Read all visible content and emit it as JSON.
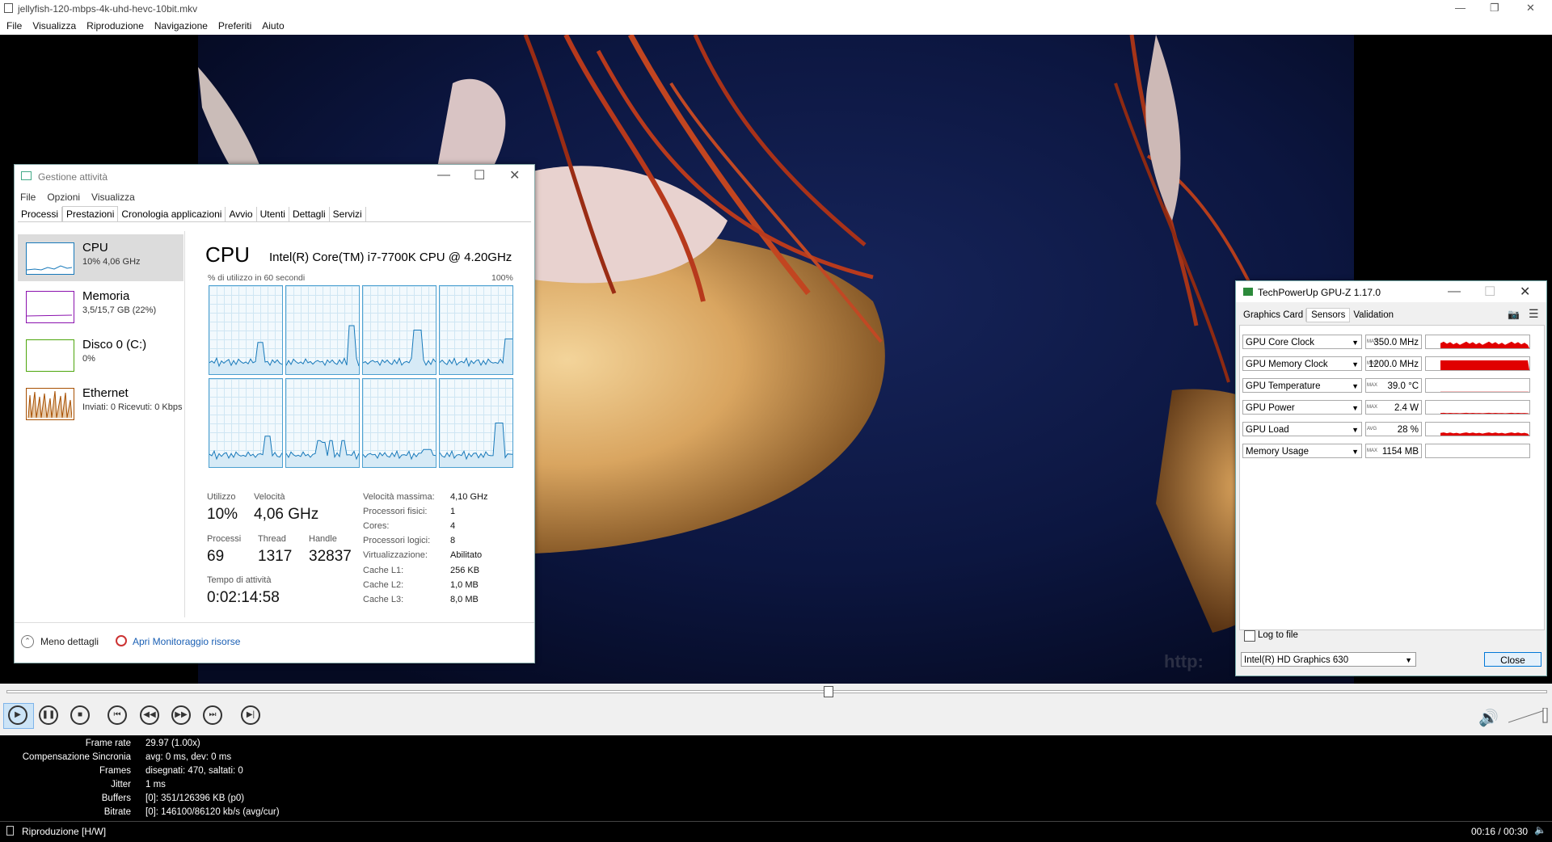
{
  "player": {
    "title": "jellyfish-120-mbps-4k-uhd-hevc-10bit.mkv",
    "menu": [
      "File",
      "Visualizza",
      "Riproduzione",
      "Navigazione",
      "Preferiti",
      "Aiuto"
    ],
    "watermark": "http:"
  },
  "stats": [
    {
      "label": "Frame rate",
      "value": "29.97 (1.00x)"
    },
    {
      "label": "Compensazione Sincronia",
      "value": "avg: 0 ms, dev: 0 ms"
    },
    {
      "label": "Frames",
      "value": "disegnati: 470, saltati: 0"
    },
    {
      "label": "Jitter",
      "value": "1 ms"
    },
    {
      "label": "Buffers",
      "value": "[0]: 351/126396 KB (p0)"
    },
    {
      "label": "Bitrate",
      "value": "[0]: 146100/86120 kb/s (avg/cur)"
    }
  ],
  "status": {
    "text": "Riproduzione [H/W]",
    "time": "00:16 / 00:30"
  },
  "seek": {
    "position": 0.533
  },
  "taskmgr": {
    "title": "Gestione attività",
    "menu": [
      "File",
      "Opzioni",
      "Visualizza"
    ],
    "tabs": [
      "Processi",
      "Prestazioni",
      "Cronologia applicazioni",
      "Avvio",
      "Utenti",
      "Dettagli",
      "Servizi"
    ],
    "sidebar": [
      {
        "name": "CPU",
        "sub": "10% 4,06 GHz",
        "color": "#1779ba"
      },
      {
        "name": "Memoria",
        "sub": "3,5/15,7 GB (22%)",
        "color": "#8b12ae"
      },
      {
        "name": "Disco 0 (C:)",
        "sub": "0%",
        "color": "#4da60c"
      },
      {
        "name": "Ethernet",
        "sub": "Inviati: 0 Ricevuti: 0 Kbps",
        "color": "#a74f01"
      }
    ],
    "cpu": {
      "heading": "CPU",
      "model": "Intel(R) Core(TM) i7-7700K CPU @ 4.20GHz",
      "graph_label": "% di utilizzo in 60 secondi",
      "graph_max": "100%",
      "utilizzo_l": "Utilizzo",
      "utilizzo_v": "10%",
      "velocita_l": "Velocità",
      "velocita_v": "4,06 GHz",
      "processi_l": "Processi",
      "processi_v": "69",
      "thread_l": "Thread",
      "thread_v": "1317",
      "handle_l": "Handle",
      "handle_v": "32837",
      "uptime_l": "Tempo di attività",
      "uptime_v": "0:02:14:58",
      "details": [
        {
          "k": "Velocità massima:",
          "v": "4,10 GHz"
        },
        {
          "k": "Processori fisici:",
          "v": "1"
        },
        {
          "k": "Cores:",
          "v": "4"
        },
        {
          "k": "Processori logici:",
          "v": "8"
        },
        {
          "k": "Virtualizzazione:",
          "v": "Abilitato"
        },
        {
          "k": "Cache L1:",
          "v": "256 KB"
        },
        {
          "k": "Cache L2:",
          "v": "1,0 MB"
        },
        {
          "k": "Cache L3:",
          "v": "8,0 MB"
        }
      ]
    },
    "footer": {
      "less": "Meno dettagli",
      "monitor": "Apri Monitoraggio risorse"
    }
  },
  "gpuz": {
    "title": "TechPowerUp GPU-Z 1.17.0",
    "tabs": [
      "Graphics Card",
      "Sensors",
      "Validation"
    ],
    "sensors": [
      {
        "name": "GPU Core Clock",
        "tag": "MAX",
        "value": "350.0 MHz"
      },
      {
        "name": "GPU Memory Clock",
        "tag": "MAX",
        "value": "1200.0 MHz"
      },
      {
        "name": "GPU Temperature",
        "tag": "MAX",
        "value": "39.0 °C"
      },
      {
        "name": "GPU Power",
        "tag": "MAX",
        "value": "2.4 W"
      },
      {
        "name": "GPU Load",
        "tag": "AVG",
        "value": "28 %"
      },
      {
        "name": "Memory Usage",
        "tag": "MAX",
        "value": "1154 MB"
      }
    ],
    "log_label": "Log to file",
    "device": "Intel(R) HD Graphics 630",
    "close": "Close"
  }
}
